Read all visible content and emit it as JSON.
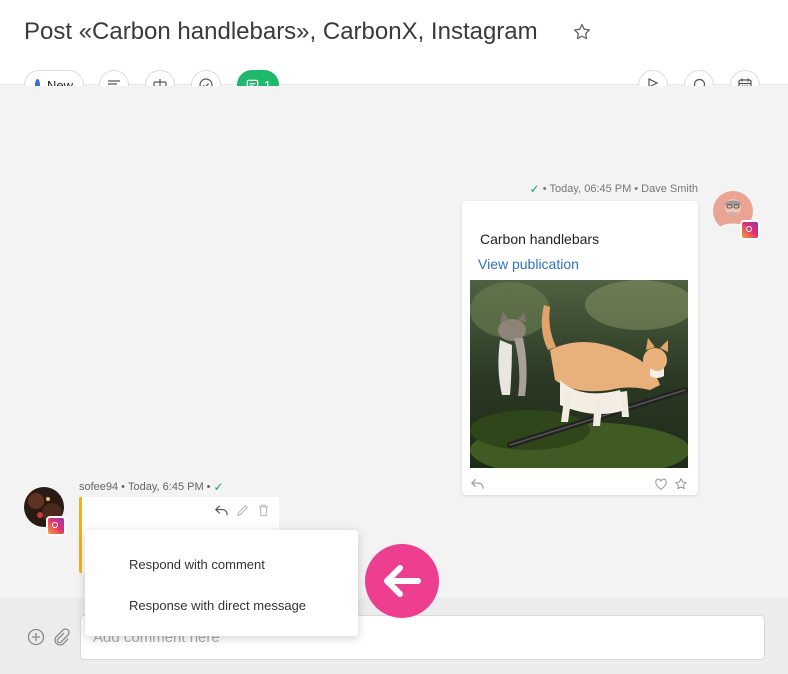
{
  "header": {
    "title": "Post «Carbon handlebars», CarbonX, Instagram",
    "status_label": "New",
    "comment_count": "1"
  },
  "colors": {
    "accent_green": "#1db86a",
    "status_blue": "#2f6fd0",
    "link_blue": "#2f73c0",
    "comment_border": "#f2b01e",
    "arrow_pink": "#ee3e8f"
  },
  "post": {
    "meta_time": "Today, 06:45 PM",
    "author": "Dave Smith",
    "title": "Carbon handlebars",
    "link_label": "View publication"
  },
  "comment": {
    "username": "sofee94",
    "time": "Today, 6:45 PM"
  },
  "reply_menu": {
    "items": [
      "Respond with comment",
      "Response with direct message"
    ]
  },
  "composer": {
    "placeholder": "Add comment here"
  },
  "icons": {
    "toolbar_left": [
      "list-icon",
      "merge-icon",
      "check-circle-icon",
      "comment-icon"
    ],
    "toolbar_right": [
      "flag-icon",
      "chat-bubble-icon",
      "calendar-icon"
    ],
    "composer": [
      "add-icon",
      "attach-icon"
    ]
  }
}
